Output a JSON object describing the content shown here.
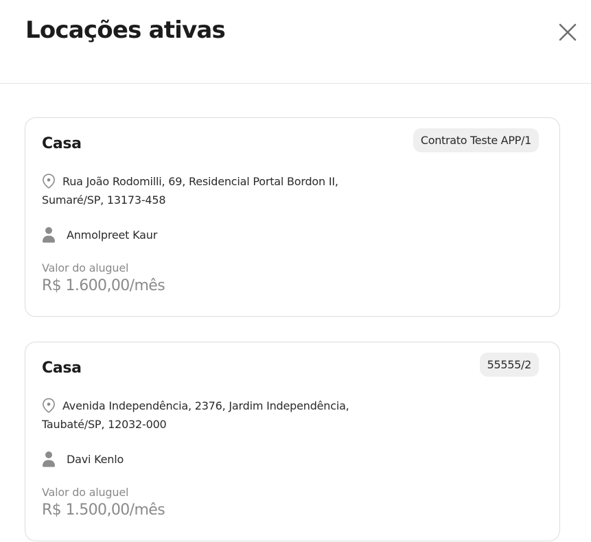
{
  "modal": {
    "title": "Locações ativas",
    "close_icon": "close-icon"
  },
  "rentals": [
    {
      "type": "Casa",
      "contract": "Contrato Teste APP/1",
      "address_line1": "Rua João Rodomilli, 69, Residencial Portal Bordon II,",
      "address_line2": "Sumaré/SP, 13173-458",
      "tenant": "Anmolpreet Kaur",
      "rent_label": "Valor do aluguel",
      "rent_value": "R$ 1.600,00/mês"
    },
    {
      "type": "Casa",
      "contract": "55555/2",
      "address_line1": "Avenida Independência, 2376, Jardim Independência,",
      "address_line2": "Taubaté/SP, 12032-000",
      "tenant": "Davi Kenlo",
      "rent_label": "Valor do aluguel",
      "rent_value": "R$ 1.500,00/mês"
    }
  ],
  "icons": {
    "location": "location-pin-icon",
    "person": "person-icon"
  },
  "colors": {
    "text": "#1c1c1c",
    "muted": "#8a8a8a",
    "icon": "#8c8c8c",
    "badge_bg": "#efefef",
    "border": "#dcdcdc"
  }
}
